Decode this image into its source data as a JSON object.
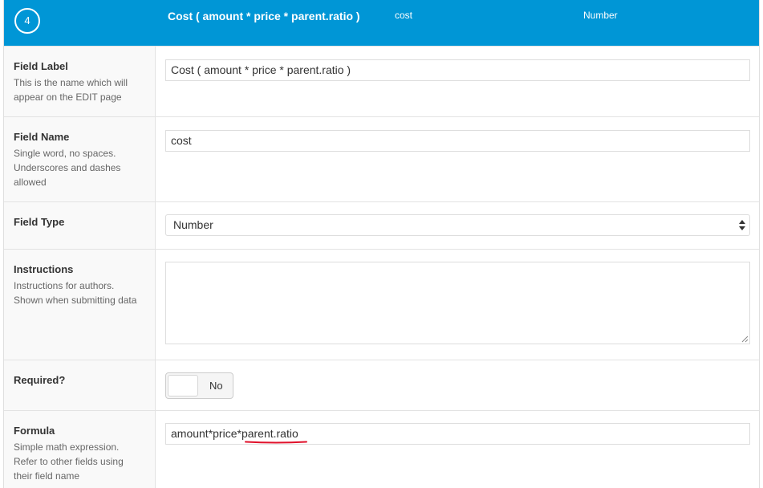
{
  "header": {
    "order": "4",
    "field_label": "Cost ( amount * price * parent.ratio )",
    "field_name": "cost",
    "field_type": "Number"
  },
  "rows": {
    "field_label": {
      "title": "Field Label",
      "desc_lines": [
        "This is the name which will",
        "appear on the EDIT page"
      ],
      "value": "Cost ( amount * price * parent.ratio )"
    },
    "field_name": {
      "title": "Field Name",
      "desc_lines": [
        "Single word, no spaces.",
        "Underscores and dashes",
        "allowed"
      ],
      "value": "cost"
    },
    "field_type": {
      "title": "Field Type",
      "selected": "Number"
    },
    "instructions": {
      "title": "Instructions",
      "desc_lines": [
        "Instructions for authors.",
        "Shown when submitting data"
      ],
      "value": ""
    },
    "required": {
      "title": "Required?",
      "toggle_label": "No"
    },
    "formula": {
      "title": "Formula",
      "desc_lines": [
        "Simple math expression.",
        "Refer to other fields using",
        "their field name"
      ],
      "value_prefix": "amount*price*",
      "value_flagged": "parent.ratio"
    }
  },
  "colors": {
    "header_bg": "#0096d6",
    "label_bg": "#f9f9f9",
    "spellcheck_underline": "#e0112b"
  }
}
